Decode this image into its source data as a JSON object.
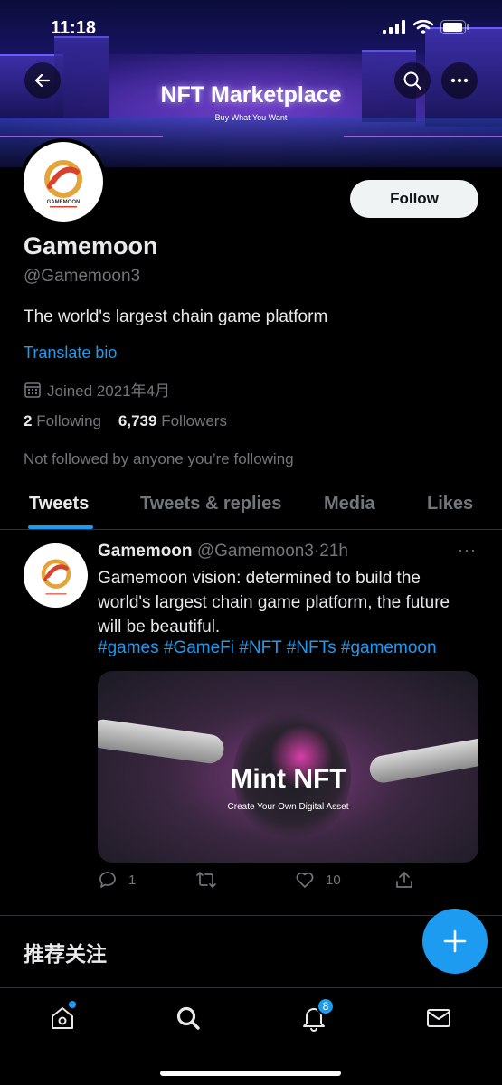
{
  "status_bar": {
    "time": "11:18"
  },
  "banner": {
    "title": "NFT Marketplace",
    "subtitle": "Buy What You Want",
    "logo_text": "GAMEMOON"
  },
  "profile": {
    "follow_label": "Follow",
    "name": "Gamemoon",
    "handle": "@Gamemoon3",
    "bio": "The world's largest chain game platform",
    "translate_label": "Translate bio",
    "joined": "Joined 2021年4月",
    "following_count": "2",
    "following_label": "Following",
    "followers_count": "6,739",
    "followers_label": "Followers",
    "not_followed": "Not followed by anyone you’re following"
  },
  "tabs": [
    {
      "label": "Tweets",
      "active": true
    },
    {
      "label": "Tweets & replies",
      "active": false
    },
    {
      "label": "Media",
      "active": false
    },
    {
      "label": "Likes",
      "active": false
    }
  ],
  "tweet": {
    "author": "Gamemoon",
    "handle": "@Gamemoon3",
    "separator": "·",
    "time": "21h",
    "more": "···",
    "text": "Gamemoon vision: determined to build the world's largest chain game platform, the future will be beautiful.",
    "hashtags": "#games #GameFi #NFT #NFTs #gamemoon",
    "media_title": "Mint NFT",
    "media_subtitle": "Create Your Own Digital Asset",
    "replies": "1",
    "retweets": "",
    "likes": "10"
  },
  "recommend_title": "推荐关注",
  "bottom_nav": {
    "notifications_badge": "8"
  },
  "colors": {
    "accent": "#1d9bf0",
    "background": "#000000",
    "text_primary": "#e7e9ea",
    "text_secondary": "#71767b"
  },
  "icons": [
    "back-arrow-icon",
    "search-icon",
    "more-icon",
    "calendar-icon",
    "reply-icon",
    "retweet-icon",
    "like-icon",
    "share-icon",
    "plus-icon",
    "home-icon",
    "explore-icon",
    "bell-icon",
    "mail-icon"
  ]
}
